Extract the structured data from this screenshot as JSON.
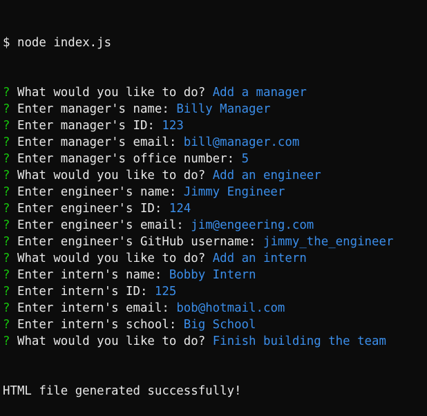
{
  "terminal": {
    "command_line": {
      "prompt": "$",
      "command": "node index.js"
    },
    "qa": [
      {
        "marker": "?",
        "question": "What would you like to do?",
        "answer": "Add a manager"
      },
      {
        "marker": "?",
        "question": "Enter manager's name:",
        "answer": "Billy Manager"
      },
      {
        "marker": "?",
        "question": "Enter manager's ID:",
        "answer": "123"
      },
      {
        "marker": "?",
        "question": "Enter manager's email:",
        "answer": "bill@manager.com"
      },
      {
        "marker": "?",
        "question": "Enter manager's office number:",
        "answer": "5"
      },
      {
        "marker": "?",
        "question": "What would you like to do?",
        "answer": "Add an engineer"
      },
      {
        "marker": "?",
        "question": "Enter engineer's name:",
        "answer": "Jimmy Engineer"
      },
      {
        "marker": "?",
        "question": "Enter engineer's ID:",
        "answer": "124"
      },
      {
        "marker": "?",
        "question": "Enter engineer's email:",
        "answer": "jim@engeering.com"
      },
      {
        "marker": "?",
        "question": "Enter engineer's GitHub username:",
        "answer": "jimmy_the_engineer"
      },
      {
        "marker": "?",
        "question": "What would you like to do?",
        "answer": "Add an intern"
      },
      {
        "marker": "?",
        "question": "Enter intern's name:",
        "answer": "Bobby Intern"
      },
      {
        "marker": "?",
        "question": "Enter intern's ID:",
        "answer": "125"
      },
      {
        "marker": "?",
        "question": "Enter intern's email:",
        "answer": "bob@hotmail.com"
      },
      {
        "marker": "?",
        "question": "Enter intern's school:",
        "answer": "Big School"
      },
      {
        "marker": "?",
        "question": "What would you like to do?",
        "answer": "Finish building the team"
      }
    ],
    "final_output": "HTML file generated successfully!",
    "colors": {
      "background": "#0c0c0c",
      "text": "#e8e8e8",
      "marker": "#16c60c",
      "answer": "#3b8eea"
    }
  }
}
